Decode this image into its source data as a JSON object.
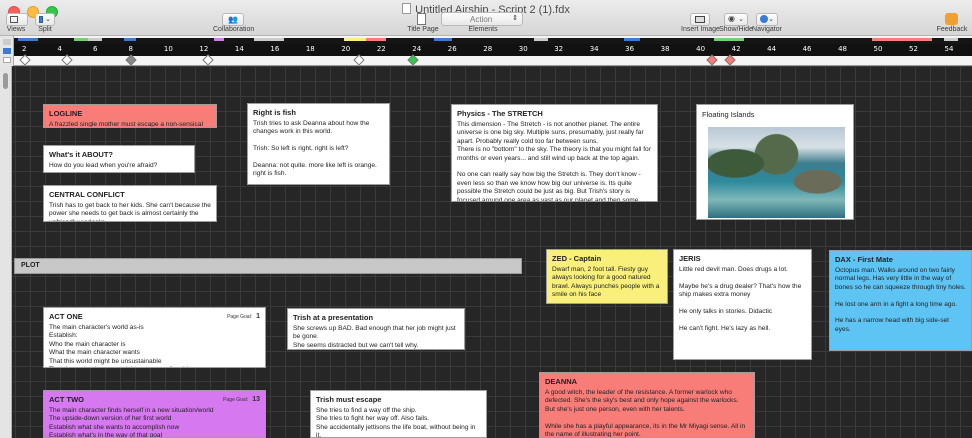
{
  "window": {
    "title": "Untitled Airship - Script 2 (1).fdx"
  },
  "toolbar": {
    "views_label": "Views",
    "split_label": "Split",
    "collaboration_label": "Collaboration",
    "titlepage_label": "Title Page",
    "elements_label": "Elements",
    "elements_value": "Action",
    "insert_image_label": "Insert Image",
    "showhide_label": "Show/Hide",
    "navigator_label": "Navigator",
    "feedback_label": "Feedback"
  },
  "timeline": {
    "pages": [
      "2",
      "4",
      "6",
      "8",
      "10",
      "12",
      "14",
      "16",
      "18",
      "20",
      "22",
      "24",
      "26",
      "28",
      "30",
      "32",
      "34",
      "36",
      "38",
      "40",
      "42",
      "44",
      "46",
      "48",
      "50",
      "52",
      "54"
    ]
  },
  "board": {
    "plot_label": "PLOT",
    "logline": {
      "title": "LOGLINE",
      "body": "A frazzled single mother must escape a non-sensical"
    },
    "what_about": {
      "title": "What's it ABOUT?",
      "body": "How do you lead when you're afraid?"
    },
    "central_conflict": {
      "title": "CENTRAL CONFLICT",
      "body": "Trish has to get back to her kids. She can't because the power she needs to get back is almost certainly the unfriendly warlocks."
    },
    "right_is_fish": {
      "title": "Right is fish",
      "body": "Trish tries to ask Deanna about how the changes work in this world.\n\nTrish: So left is right, right is left?\n\nDeanna: not quite. more like left is orange. right is fish."
    },
    "physics": {
      "title": "Physics - The STRETCH",
      "body": "This dimension - The Stretch - is not another planet. The entire universe is one big sky. Multiple suns, presumably, just really far apart. Probably really cold too far between suns.\nThere is no \"bottom\" to the sky. The theory is that you might fall for months or even years... and still wind up back at the top again.\n\nNo one can really say how big the Stretch is. They don't know - even less so than we know how big our universe is. Its quite possible the Stretch could be just as big. But Trish's story is focused around one area as vast as our planet and then some."
    },
    "floating_islands": {
      "title": "Floating Islands"
    },
    "zed": {
      "title": "ZED - Captain",
      "body": "Dwarf man, 2 foot tall. Fiesty guy always looking for a good natured brawl. Always punches people with a smile on his face"
    },
    "jeris": {
      "title": "JERIS",
      "body": "Little red devil man. Does drugs a lot.\n\nMaybe he's a drug dealer? That's how the ship makes extra money\n\nHe only talks in stories. Didactic\n\nHe can't fight. He's lazy as hell."
    },
    "dax": {
      "title": "DAX - First Mate",
      "body": "Octopus man. Walks around on two fairly normal legs. Has very little in the way of bones so he can squeeze through tiny holes.\n\nHe lost one arm in a fight a long time ago.\n\nHe has a narrow head with big side-set eyes."
    },
    "act_one": {
      "title": "ACT ONE",
      "goal_label": "Page Goal:",
      "goal_value": "1",
      "body": "The main character's world as-is\nEstablish:\nWho the main character is\nWhat the main character wants\nThat this world might be unsustainable\nThat the main character might not yet realize this"
    },
    "trish_presentation": {
      "title": "Trish at a presentation",
      "body": "She screws up BAD. Bad enough that her job might just be gone.\nShe seems distracted but we can't tell why."
    },
    "deanna": {
      "title": "DEANNA",
      "body": "A good witch, the leader of the resistance. A former warlock who defected. She's the sky's best and only hope against the warlocks. But she's just one person, even with her talents.\n\nWhile she has a playful appearance, its in the Mr Miyagi sense. All in the name of illustrating her point."
    },
    "act_two": {
      "title": "ACT TWO",
      "goal_label": "Page Goal:",
      "goal_value": "13",
      "body": "The main character finds herself in a new situation/world\nThe upside-down version of her first world\nEstablish what she wants to accomplish now\nEstablish what's in the way of that goal"
    },
    "trish_escape": {
      "title": "Trish must escape",
      "body": "She tries to find a way off the ship.\nShe tries to fight her way off. Also fails.\nShe accidentally jettisons the life boat, without being in it.\nBut the lifeboat serves as a distraction and the airship is able"
    }
  },
  "colors": {
    "logline": "#f87c78",
    "zed": "#f8f07a",
    "dax": "#5ec4f4",
    "deanna": "#f87c78",
    "act_two": "#d678f0",
    "board_bg": "#262626"
  }
}
